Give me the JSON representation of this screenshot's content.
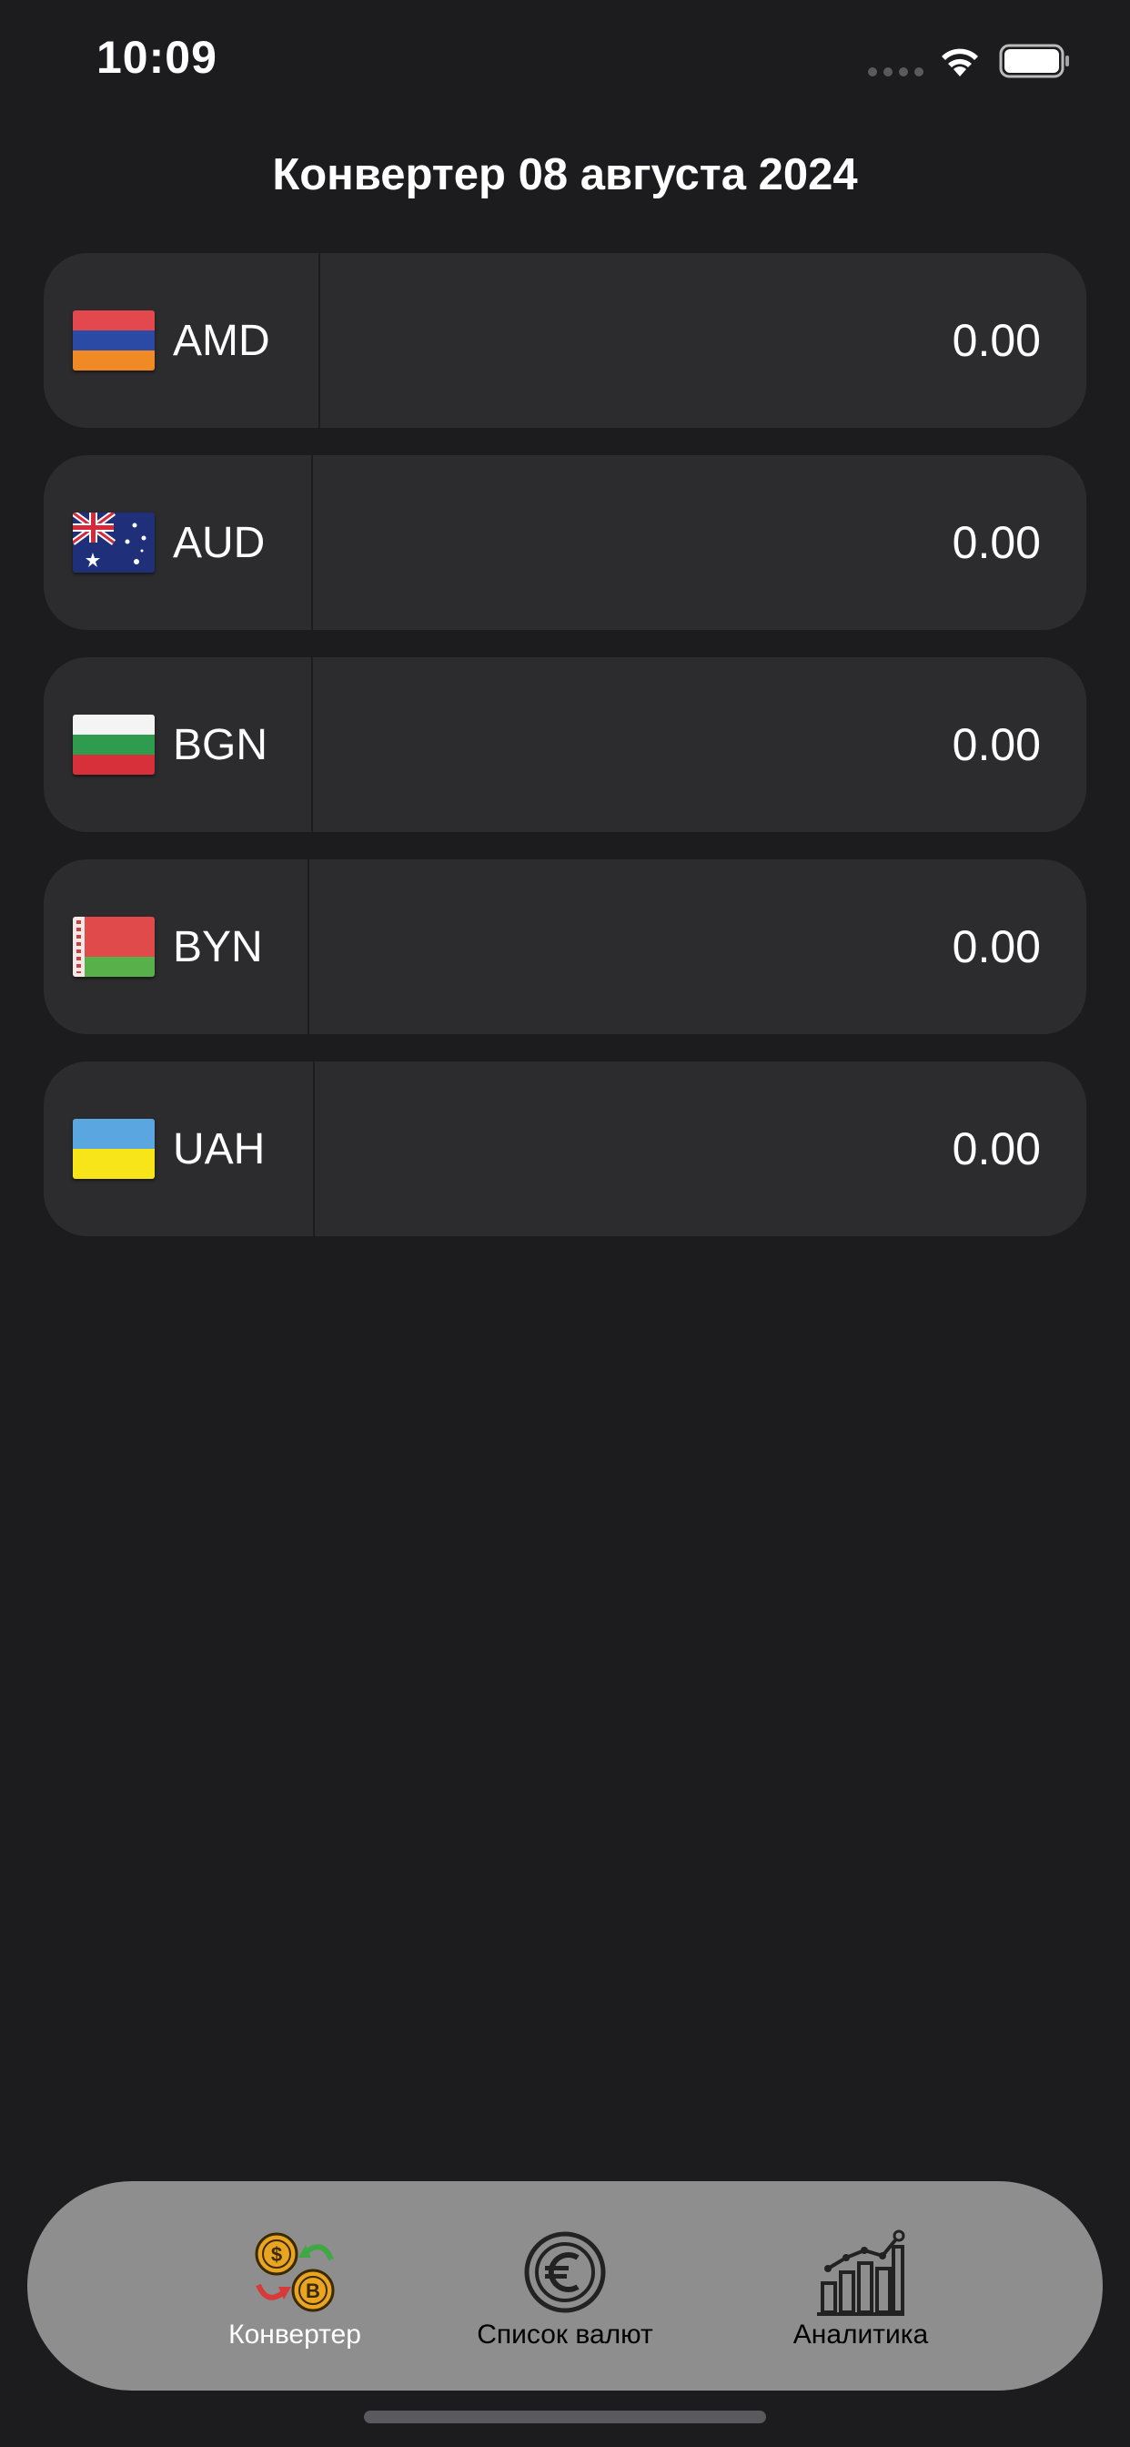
{
  "status_bar": {
    "time": "10:09"
  },
  "header": {
    "title": "Конвертер 08 августа 2024"
  },
  "currencies": [
    {
      "code": "AMD",
      "amount": "0.00",
      "flag": "armenia-flag",
      "flag_colors": [
        "#d90012",
        "#0033a0",
        "#f2a800"
      ]
    },
    {
      "code": "AUD",
      "amount": "0.00",
      "flag": "australia-flag",
      "flag_colors": [
        "#012169",
        "#ffffff",
        "#e4002b"
      ]
    },
    {
      "code": "BGN",
      "amount": "0.00",
      "flag": "bulgaria-flag",
      "flag_colors": [
        "#ffffff",
        "#00966e",
        "#d62612"
      ]
    },
    {
      "code": "BYN",
      "amount": "0.00",
      "flag": "belarus-flag",
      "flag_colors": [
        "#c8313e",
        "#4aa657",
        "#ffffff"
      ]
    },
    {
      "code": "UAH",
      "amount": "0.00",
      "flag": "ukraine-flag",
      "flag_colors": [
        "#0057b7",
        "#ffd700"
      ]
    }
  ],
  "tab_bar": {
    "tabs": [
      {
        "label": "Конвертер",
        "icon": "currency-exchange-icon",
        "active": true
      },
      {
        "label": "Список валют",
        "icon": "euro-coin-icon",
        "active": false
      },
      {
        "label": "Аналитика",
        "icon": "bar-chart-growth-icon",
        "active": false
      }
    ]
  },
  "colors": {
    "background": "#1c1c1e",
    "row_background": "#2c2c2e",
    "tab_bar_background": "#8e8e8e",
    "text": "#ffffff"
  }
}
